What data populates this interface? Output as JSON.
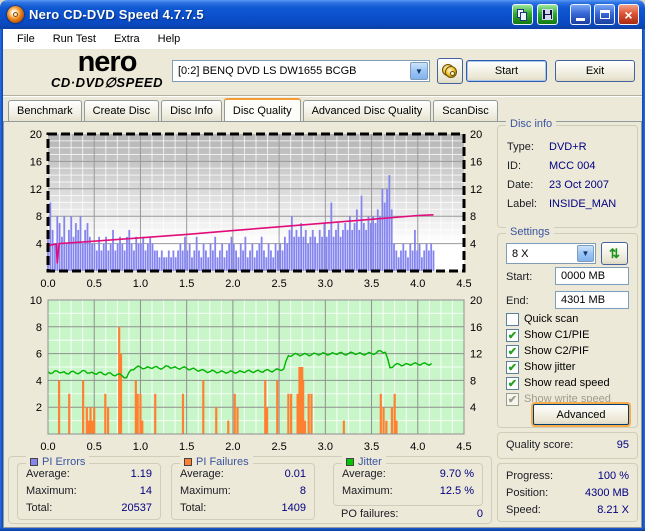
{
  "window": {
    "title": "Nero CD-DVD Speed 4.7.7.5"
  },
  "menu": {
    "items": [
      "File",
      "Run Test",
      "Extra",
      "Help"
    ]
  },
  "header": {
    "logo_line1": "nero",
    "logo_line2": "CD·DVD∅SPEED",
    "drive_selector": "[0:2] BENQ DVD LS DW1655 BCGB",
    "start_button": "Start",
    "exit_button": "Exit"
  },
  "tabs": {
    "items": [
      "Benchmark",
      "Create Disc",
      "Disc Info",
      "Disc Quality",
      "Advanced Disc Quality",
      "ScanDisc"
    ],
    "active": "Disc Quality"
  },
  "disc_info": {
    "title": "Disc info",
    "rows": [
      {
        "label": "Type:",
        "value": "DVD+R"
      },
      {
        "label": "ID:",
        "value": "MCC 004"
      },
      {
        "label": "Date:",
        "value": "23 Oct 2007"
      },
      {
        "label": "Label:",
        "value": "INSIDE_MAN"
      }
    ]
  },
  "settings": {
    "title": "Settings",
    "speed_selected": "8 X",
    "start_label": "Start:",
    "start_value": "0000 MB",
    "end_label": "End:",
    "end_value": "4301 MB",
    "checkboxes": [
      {
        "label": "Quick scan",
        "checked": false,
        "disabled": false
      },
      {
        "label": "Show C1/PIE",
        "checked": true,
        "disabled": false
      },
      {
        "label": "Show C2/PIF",
        "checked": true,
        "disabled": false
      },
      {
        "label": "Show jitter",
        "checked": true,
        "disabled": false
      },
      {
        "label": "Show read speed",
        "checked": true,
        "disabled": false
      },
      {
        "label": "Show write speed",
        "checked": true,
        "disabled": true
      }
    ],
    "advanced_button": "Advanced"
  },
  "quality": {
    "label": "Quality score:",
    "value": "95"
  },
  "progress_panel": {
    "rows": [
      {
        "label": "Progress:",
        "value": "100 %"
      },
      {
        "label": "Position:",
        "value": "4300 MB"
      },
      {
        "label": "Speed:",
        "value": "8.21 X"
      }
    ]
  },
  "stats": {
    "pi_errors": {
      "title": "PI Errors",
      "color": "#8585f0",
      "rows": [
        {
          "label": "Average:",
          "value": "1.19"
        },
        {
          "label": "Maximum:",
          "value": "14"
        },
        {
          "label": "Total:",
          "value": "20537"
        }
      ]
    },
    "pi_failures": {
      "title": "PI Failures",
      "color": "#ff8030",
      "rows": [
        {
          "label": "Average:",
          "value": "0.01"
        },
        {
          "label": "Maximum:",
          "value": "8"
        },
        {
          "label": "Total:",
          "value": "1409"
        }
      ]
    },
    "jitter": {
      "title": "Jitter",
      "color": "#00c800",
      "rows": [
        {
          "label": "Average:",
          "value": "9.70 %"
        },
        {
          "label": "Maximum:",
          "value": "12.5 %"
        }
      ]
    },
    "po_failures": {
      "label": "PO failures:",
      "value": "0"
    }
  },
  "chart_data": [
    {
      "type": "bar",
      "title": "PI Errors and read speed vs disc position (GB)",
      "x_axis": {
        "min": 0,
        "max": 4.5,
        "tick": 0.5,
        "labels": [
          "0.0",
          "0.5",
          "1.0",
          "1.5",
          "2.0",
          "2.5",
          "3.0",
          "3.5",
          "4.0",
          "4.5"
        ]
      },
      "y_left": {
        "min": 0,
        "max": 20,
        "tick": 4,
        "labels": [
          4,
          8,
          12,
          16,
          20
        ]
      },
      "y_right": {
        "min": 0,
        "max": 20,
        "tick": 4,
        "labels": [
          4,
          8,
          12,
          16,
          20
        ]
      },
      "series": [
        {
          "name": "PI Errors",
          "kind": "bars",
          "color": "#8585f0",
          "x_start": 0,
          "x_end": 4.17,
          "values": [
            5,
            10,
            6,
            4,
            8,
            7,
            5,
            8,
            4,
            6,
            8,
            5,
            7,
            6,
            8,
            4,
            6,
            7,
            5,
            4,
            4,
            3,
            5,
            3,
            4,
            5,
            3,
            4,
            6,
            3,
            4,
            5,
            4,
            3,
            5,
            6,
            4,
            3,
            5,
            4,
            4,
            5,
            3,
            4,
            5,
            4,
            3,
            3,
            2,
            3,
            2,
            2,
            3,
            2,
            3,
            2,
            3,
            4,
            3,
            5,
            3,
            4,
            2,
            3,
            5,
            3,
            2,
            4,
            3,
            2,
            4,
            3,
            5,
            2,
            3,
            4,
            2,
            3,
            4,
            5,
            4,
            3,
            2,
            4,
            3,
            5,
            2,
            3,
            4,
            2,
            3,
            4,
            5,
            3,
            2,
            4,
            3,
            2,
            4,
            3,
            4,
            3,
            5,
            4,
            6,
            8,
            5,
            6,
            5,
            7,
            5,
            6,
            4,
            5,
            6,
            5,
            4,
            6,
            5,
            7,
            5,
            6,
            10,
            5,
            6,
            7,
            5,
            6,
            7,
            6,
            8,
            6,
            7,
            9,
            6,
            11,
            7,
            6,
            8,
            7,
            8,
            7,
            9,
            8,
            12,
            10,
            12,
            14,
            9,
            4,
            3,
            2,
            3,
            4,
            3,
            2,
            4,
            3,
            6,
            3,
            4,
            2,
            3,
            4,
            3,
            4,
            3
          ]
        },
        {
          "name": "Read speed (X)",
          "kind": "line",
          "color": "#e00d7a",
          "points": [
            [
              0,
              3.7
            ],
            [
              0.07,
              3.9
            ],
            [
              0.09,
              3.95
            ],
            [
              0.1,
              1.1
            ],
            [
              0.12,
              4.0
            ],
            [
              0.5,
              4.35
            ],
            [
              1.0,
              4.85
            ],
            [
              1.5,
              5.35
            ],
            [
              2.0,
              5.9
            ],
            [
              2.5,
              6.45
            ],
            [
              3.0,
              7.0
            ],
            [
              3.5,
              7.55
            ],
            [
              4.0,
              8.1
            ],
            [
              4.17,
              8.2
            ]
          ]
        }
      ]
    },
    {
      "type": "bar",
      "title": "PI Failures and jitter vs disc position (GB)",
      "x_axis": {
        "min": 0,
        "max": 4.5,
        "tick": 0.5,
        "labels": [
          "0.0",
          "0.5",
          "1.0",
          "1.5",
          "2.0",
          "2.5",
          "3.0",
          "3.5",
          "4.0",
          "4.5"
        ]
      },
      "y_left": {
        "min": 0,
        "max": 10,
        "tick": 2,
        "labels": [
          2,
          4,
          6,
          8,
          10
        ]
      },
      "y_right": {
        "min": 0,
        "max": 20,
        "tick": 4,
        "labels": [
          4,
          8,
          12,
          16,
          20
        ]
      },
      "series": [
        {
          "name": "PI Failures",
          "kind": "bars",
          "axis": "left",
          "color": "#ff8030",
          "pairs": [
            [
              0.12,
              4
            ],
            [
              0.23,
              3
            ],
            [
              0.38,
              4
            ],
            [
              0.42,
              2
            ],
            [
              0.44,
              1
            ],
            [
              0.46,
              2
            ],
            [
              0.48,
              1
            ],
            [
              0.5,
              2
            ],
            [
              0.62,
              3
            ],
            [
              0.65,
              2
            ],
            [
              0.77,
              8
            ],
            [
              0.79,
              6
            ],
            [
              0.95,
              4
            ],
            [
              0.97,
              3
            ],
            [
              1.0,
              3
            ],
            [
              1.02,
              1
            ],
            [
              1.16,
              3
            ],
            [
              1.46,
              3
            ],
            [
              1.68,
              4
            ],
            [
              1.82,
              2
            ],
            [
              1.95,
              1
            ],
            [
              2.02,
              3
            ],
            [
              2.05,
              2
            ],
            [
              2.35,
              4
            ],
            [
              2.37,
              2
            ],
            [
              2.48,
              4
            ],
            [
              2.6,
              3
            ],
            [
              2.63,
              3
            ],
            [
              2.7,
              3
            ],
            [
              2.72,
              5
            ],
            [
              2.73,
              5
            ],
            [
              2.74,
              5
            ],
            [
              2.75,
              5
            ],
            [
              2.76,
              4
            ],
            [
              2.78,
              1
            ],
            [
              2.82,
              3
            ],
            [
              2.85,
              3
            ],
            [
              3.2,
              1
            ],
            [
              3.6,
              3
            ],
            [
              3.63,
              2
            ],
            [
              3.66,
              1
            ],
            [
              3.72,
              2
            ],
            [
              3.75,
              3
            ],
            [
              3.77,
              1
            ]
          ]
        },
        {
          "name": "Jitter (%)",
          "kind": "line",
          "axis": "right",
          "color": "#00b400",
          "x_start": 0,
          "x_end": 4.15,
          "values": [
            9.3,
            9.1,
            9.4,
            9.2,
            9.0,
            9.3,
            9.1,
            9.2,
            9.4,
            9.1,
            9.0,
            9.2,
            8.9,
            9.1,
            8.8,
            8.9,
            8.7,
            8.4,
            9.6,
            9.9,
            10.0,
            9.8,
            9.9,
            10.0,
            9.8,
            9.9,
            10.1,
            9.9,
            9.8,
            9.9,
            9.8,
            9.7,
            9.6,
            9.5,
            9.4,
            9.3,
            9.4,
            9.2,
            9.3,
            9.2,
            9.3,
            9.2,
            9.3,
            9.4,
            9.3,
            9.4,
            9.3,
            9.5,
            9.4,
            9.5,
            9.6,
            9.7,
            11.7,
            11.8,
            11.9,
            11.8,
            11.9,
            11.8,
            12.0,
            11.9,
            12.0,
            11.9,
            12.0,
            12.1,
            11.9,
            12.0,
            12.1,
            12.0,
            11.9,
            12.0,
            12.0,
            12.1,
            12.4,
            12.2,
            9.9,
            10.3,
            10.4,
            10.3,
            10.4,
            10.5,
            10.4,
            10.5,
            10.4,
            10.5
          ]
        }
      ]
    }
  ]
}
